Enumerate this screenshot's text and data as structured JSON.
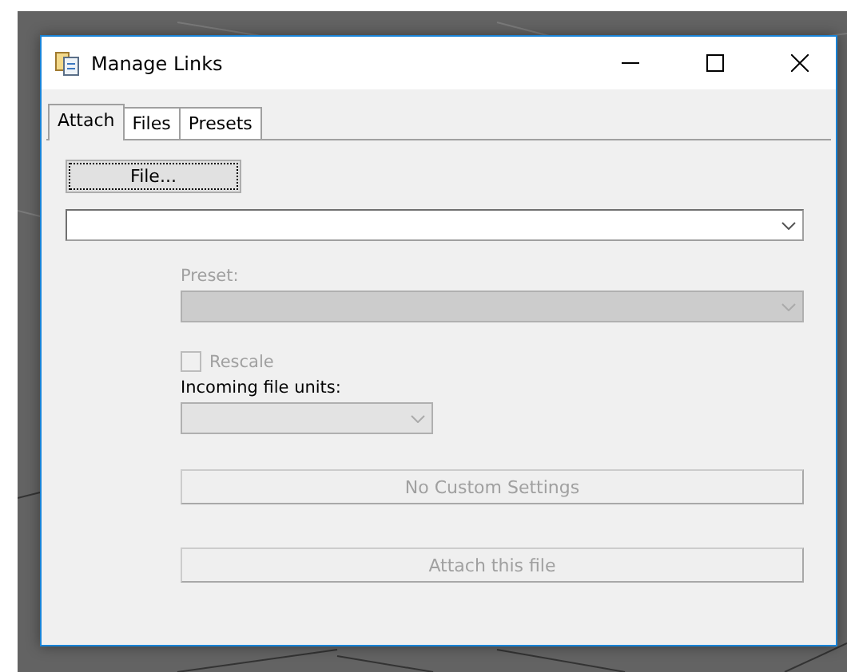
{
  "window": {
    "title": "Manage Links"
  },
  "tabs": [
    {
      "label": "Attach",
      "selected": true
    },
    {
      "label": "Files",
      "selected": false
    },
    {
      "label": "Presets",
      "selected": false
    }
  ],
  "file_button": {
    "label": "File...",
    "focused": true
  },
  "file_combo": {
    "disabled": false
  },
  "preset": {
    "label": "Preset:",
    "disabled": true
  },
  "rescale": {
    "label": "Rescale",
    "checked": false,
    "disabled": true
  },
  "incoming_units": {
    "label": "Incoming file units:",
    "disabled": true
  },
  "buttons": [
    {
      "label": "No Custom Settings",
      "disabled": true
    },
    {
      "label": "Attach this file",
      "disabled": true
    }
  ]
}
